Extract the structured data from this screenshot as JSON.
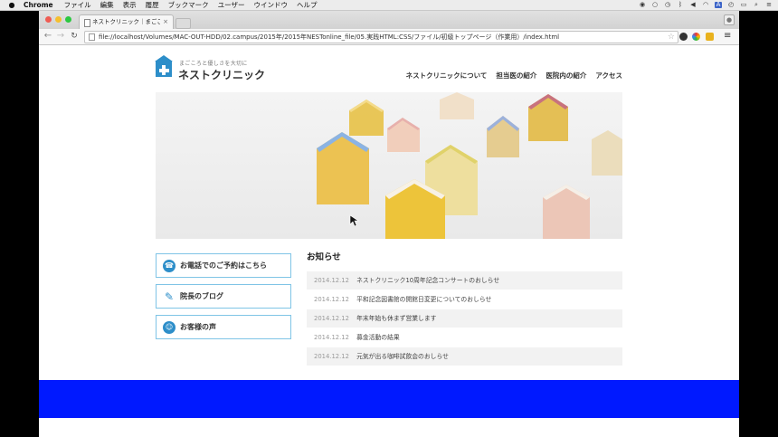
{
  "menubar": {
    "app_name": "Chrome",
    "items": [
      "ファイル",
      "編集",
      "表示",
      "履歴",
      "ブックマーク",
      "ユーザー",
      "ウインドウ",
      "ヘルプ"
    ]
  },
  "browser": {
    "tab_title": "ネストクリニック｜まごころ",
    "url": "file://localhost/Volumes/MAC-OUT-HDD/02.campus/2015年/2015年NESTonline_file/05.実践HTML:CSS/ファイル/初級トップページ（作業用）/index.html"
  },
  "site": {
    "tagline": "まごころと優しさを大切に",
    "name": "ネストクリニック",
    "nav": [
      "ネストクリニックについて",
      "担当医の紹介",
      "医院内の紹介",
      "アクセス"
    ]
  },
  "sidebar": {
    "items": [
      {
        "label": "お電話でのご予約はこちら",
        "icon": "telephone-icon"
      },
      {
        "label": "院長のブログ",
        "icon": "pencil-icon"
      },
      {
        "label": "お客様の声",
        "icon": "smile-icon"
      }
    ]
  },
  "news": {
    "title": "お知らせ",
    "items": [
      {
        "date": "2014.12.12",
        "text": "ネストクリニック10周年記念コンサートのおしらせ"
      },
      {
        "date": "2014.12.12",
        "text": "平和記念図書館の開館日変更についてのおしらせ"
      },
      {
        "date": "2014.12.12",
        "text": "年末年始も休まず営業します"
      },
      {
        "date": "2014.12.12",
        "text": "募金活動の結果"
      },
      {
        "date": "2014.12.12",
        "text": "元気が出る咖啡試飲会のおしらせ"
      }
    ]
  },
  "colors": {
    "brand_blue": "#2d8ec9",
    "footer_blue": "#0019ff",
    "button_border": "#7fc4e6"
  }
}
